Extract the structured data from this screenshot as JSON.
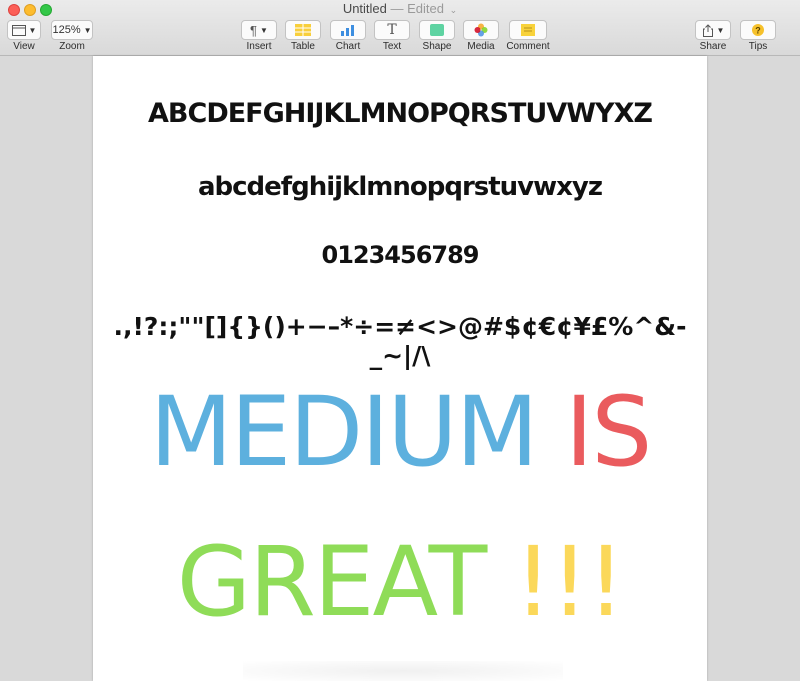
{
  "window": {
    "title": "Untitled",
    "edited": "— Edited"
  },
  "toolbar": {
    "view_label": "View",
    "zoom_value": "125%",
    "zoom_label": "Zoom",
    "insert_label": "Insert",
    "table_label": "Table",
    "chart_label": "Chart",
    "text_label": "Text",
    "shape_label": "Shape",
    "media_label": "Media",
    "comment_label": "Comment",
    "share_label": "Share",
    "tips_label": "Tips"
  },
  "document": {
    "uppercase": "ABCDEFGHIJKLMNOPQRSTUVWYXZ",
    "lowercase": "abcdefghijklmnopqrstuvwxyz",
    "digits": "0123456789",
    "symbols": ".,!?:;\"\"[]{}()+−–*÷=≠<>@#$¢€¢¥£%^&-_~|/\\",
    "headline_word1": "MEDIUM",
    "headline_word2": "IS",
    "headline_word3": "GREAT",
    "headline_word4": "!!!"
  },
  "colors": {
    "blue": "#5db0de",
    "red": "#ea5b5e",
    "green": "#8fdc58",
    "yellow": "#fbd85a"
  }
}
